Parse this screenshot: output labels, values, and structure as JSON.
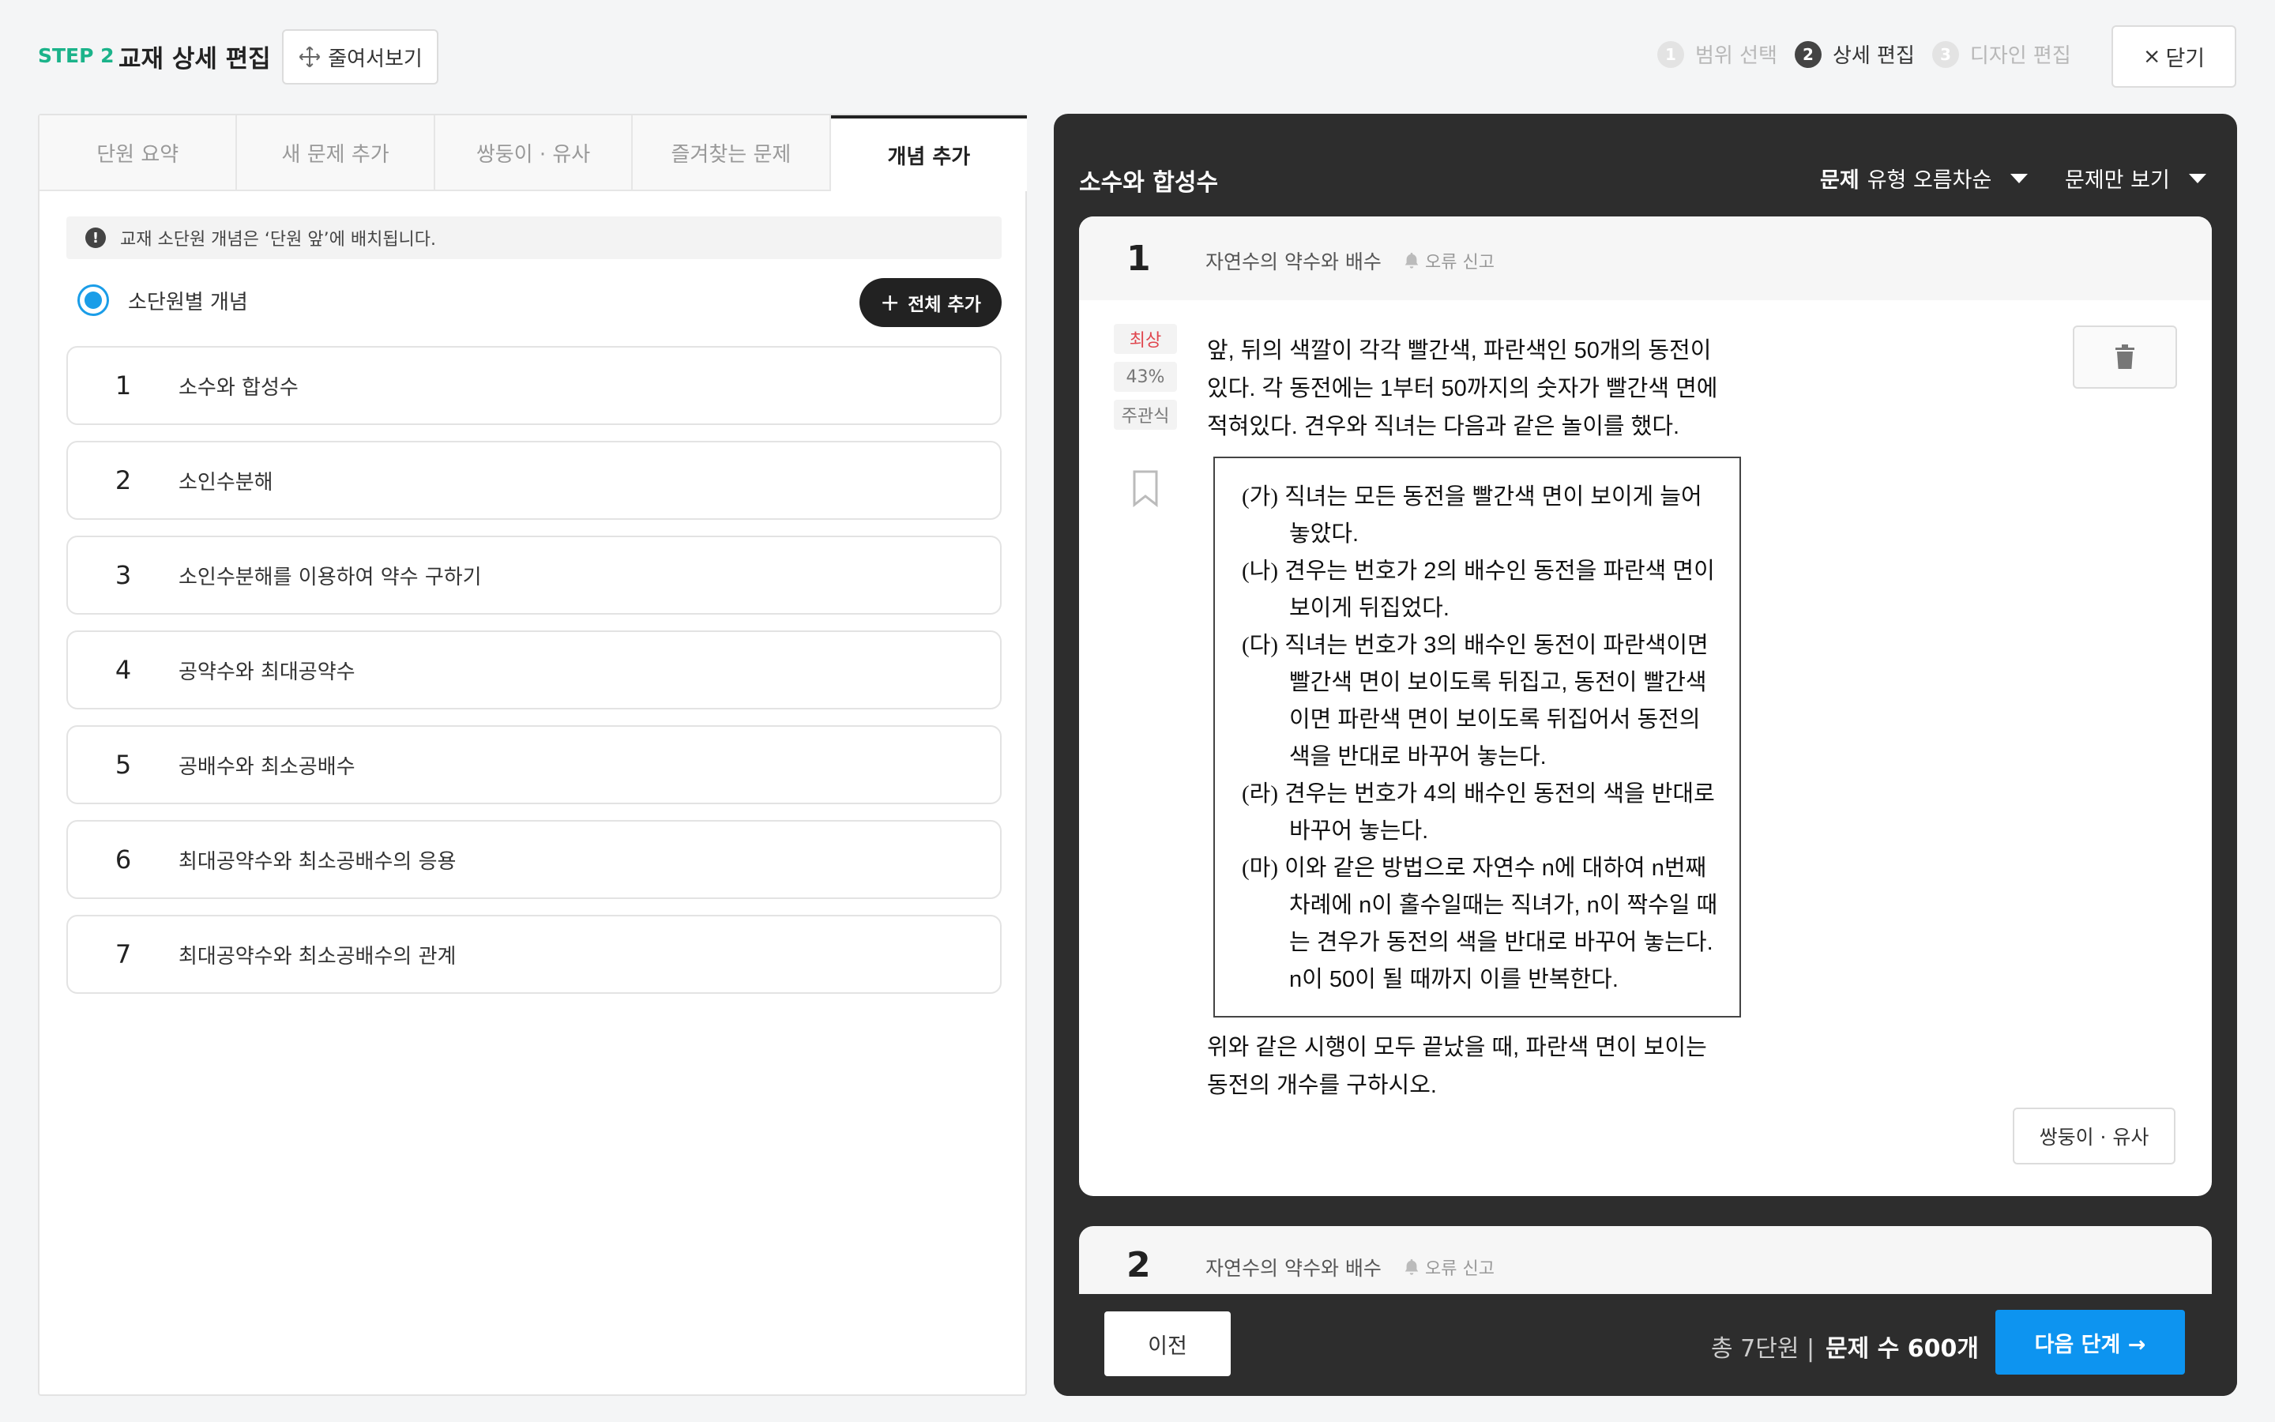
{
  "header": {
    "step_label": "STEP 2",
    "title": "교재 상세 편집",
    "zoom_button": "줄여서보기",
    "steps": [
      {
        "num": "1",
        "label": "범위 선택",
        "state": "inactive"
      },
      {
        "num": "2",
        "label": "상세 편집",
        "state": "active"
      },
      {
        "num": "3",
        "label": "디자인 편집",
        "state": "inactive"
      }
    ],
    "close_button": "닫기",
    "close_icon": "×"
  },
  "left_panel": {
    "tabs": [
      {
        "label": "단원 요약",
        "active": false
      },
      {
        "label": "새 문제 추가",
        "active": false
      },
      {
        "label": "쌍둥이  ·  유사",
        "active": false
      },
      {
        "label": "즐겨찾는 문제",
        "active": false
      },
      {
        "label": "개념 추가",
        "active": true
      }
    ],
    "notice": "교재 소단원 개념은 ‘단원 앞’에 배치됩니다.",
    "radio_label": "소단원별 개념",
    "add_all_button": "전체 추가",
    "concepts": [
      {
        "num": "1",
        "label": "소수와 합성수"
      },
      {
        "num": "2",
        "label": "소인수분해"
      },
      {
        "num": "3",
        "label": "소인수분해를 이용하여 약수 구하기"
      },
      {
        "num": "4",
        "label": "공약수와 최대공약수"
      },
      {
        "num": "5",
        "label": "공배수와 최소공배수"
      },
      {
        "num": "6",
        "label": "최대공약수와 최소공배수의 응용"
      },
      {
        "num": "7",
        "label": "최대공약수와 최소공배수의 관계"
      }
    ]
  },
  "right_panel": {
    "title": "소수와 합성수",
    "sort_bold": "문제",
    "sort_rest": "유형 오름차순",
    "filter": "문제만 보기",
    "question1": {
      "num": "1",
      "unit": "자연수의 약수와 배수",
      "report": "오류 신고",
      "level": "최상",
      "rate": "43%",
      "type": "주관식",
      "intro": "앞, 뒤의 색깔이 각각 빨간색, 파란색인 50개의 동전이 있다. 각 동전에는 1부터 50까지의 숫자가 빨간색 면에 적혀있다. 견우와 직녀는 다음과 같은 놀이를 했다.",
      "steps": [
        {
          "mark": "(가)",
          "text": "직녀는 모든 동전을 빨간색 면이 보이게 늘어놓았다."
        },
        {
          "mark": "(나)",
          "text": "견우는 번호가 2의 배수인 동전을 파란색 면이 보이게 뒤집었다."
        },
        {
          "mark": "(다)",
          "text": "직녀는 번호가 3의 배수인 동전이 파란색이면 빨간색 면이 보이도록 뒤집고, 동전이 빨간색이면 파란색 면이 보이도록 뒤집어서 동전의 색을 반대로 바꾸어 놓는다."
        },
        {
          "mark": "(라)",
          "text": "견우는 번호가 4의 배수인 동전의 색을 반대로 바꾸어 놓는다."
        },
        {
          "mark": "(마)",
          "text": "이와 같은 방법으로 자연수 n에 대하여 n번째 차례에 n이 홀수일때는 직녀가, n이 짝수일 때는 견우가 동전의 색을 반대로 바꾸어 놓는다. n이 50이 될 때까지 이를 반복한다."
        }
      ],
      "question": "위와 같은 시행이 모두 끝났을 때, 파란색 면이 보이는 동전의 개수를 구하시오.",
      "twin_button": "쌍둥이  ·  유사"
    },
    "question2": {
      "num": "2",
      "unit": "자연수의 약수와 배수",
      "report": "오류 신고"
    },
    "footer": {
      "prev_button": "이전",
      "total_units": "총 7단원 |",
      "total_questions": "문제 수 600개",
      "next_button": "다음 단계 →"
    }
  },
  "colors": {
    "accent_green": "#1bb38a",
    "accent_blue": "#0d94f0",
    "level_red": "#e0454d",
    "dark_panel": "#2d2d2d"
  }
}
